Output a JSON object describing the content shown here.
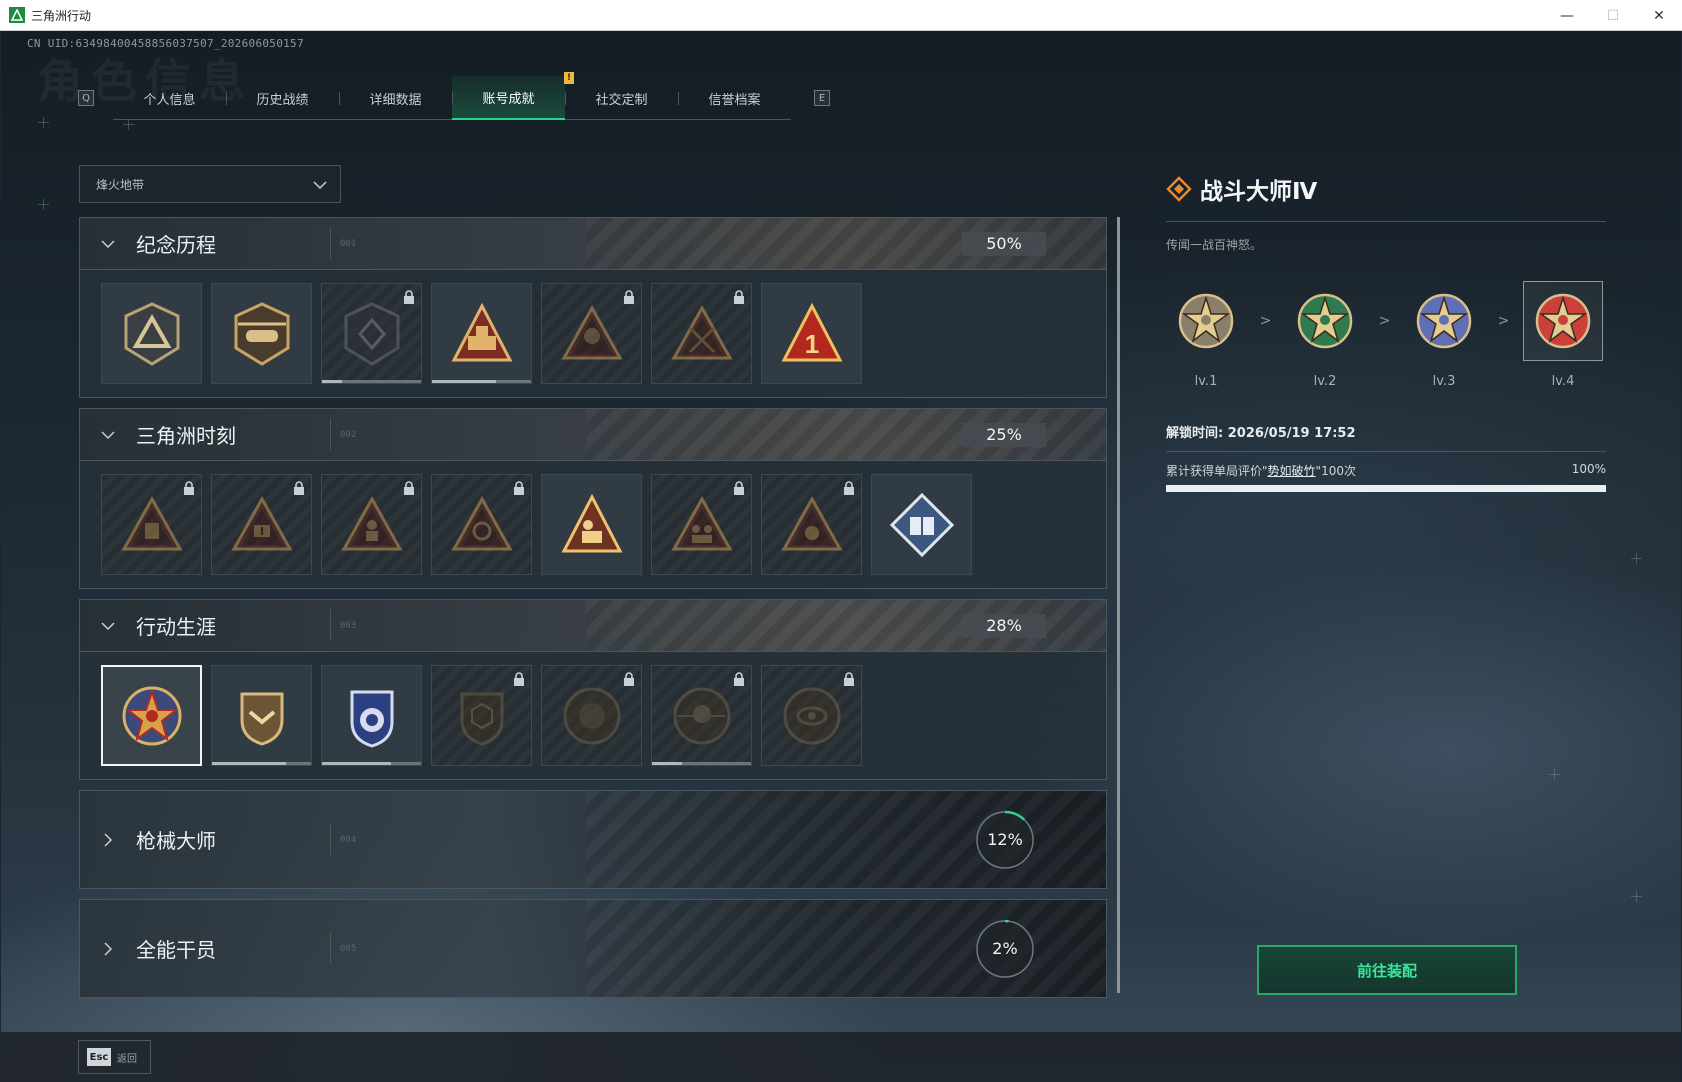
{
  "window": {
    "title": "三角洲行动",
    "minimize": "—",
    "maximize": "☐",
    "close": "✕"
  },
  "uid": "CN UID:6349840045885603750​7_202606050157",
  "bg_title": "角色信息",
  "tabs": {
    "prev_key": "Q",
    "next_key": "E",
    "items": [
      {
        "label": "个人信息"
      },
      {
        "label": "历史战绩"
      },
      {
        "label": "详细数据"
      },
      {
        "label": "账号成就"
      },
      {
        "label": "社交定制"
      },
      {
        "label": "信誉档案"
      }
    ],
    "active": "账号成就",
    "notice": "!"
  },
  "filter": {
    "value": "烽火地带"
  },
  "sections": [
    {
      "name": "纪念历程",
      "code": "001",
      "percent": "50%"
    },
    {
      "name": "三角洲时刻",
      "code": "002",
      "percent": "25%"
    },
    {
      "name": "行动生涯",
      "code": "003",
      "percent": "28%"
    },
    {
      "name": "枪械大师",
      "code": "004",
      "percent": "12%",
      "progress": 0.12
    },
    {
      "name": "全能干员",
      "code": "005",
      "percent": "2%",
      "progress": 0.02
    }
  ],
  "badges": {
    "memorial": [
      {
        "icon": "delta-triangle-badge-icon",
        "locked": false
      },
      {
        "icon": "helicopter-badge-icon",
        "locked": false
      },
      {
        "icon": "shield-emblem-badge-icon",
        "locked": true,
        "progress": 0.2
      },
      {
        "icon": "tank-badge-icon",
        "locked": false,
        "progress": 0.65
      },
      {
        "icon": "hooded-figure-badge-icon",
        "locked": true
      },
      {
        "icon": "crossed-swords-badge-icon",
        "locked": true
      },
      {
        "icon": "number-one-badge-icon",
        "locked": false
      }
    ],
    "moments": [
      {
        "icon": "backpack-triangle-icon",
        "locked": true
      },
      {
        "icon": "medkit-triangle-icon",
        "locked": true
      },
      {
        "icon": "soldier-triangle-icon",
        "locked": true
      },
      {
        "icon": "hands-triangle-icon",
        "locked": true
      },
      {
        "icon": "carry-triangle-icon",
        "locked": false
      },
      {
        "icon": "squad-triangle-icon",
        "locked": true
      },
      {
        "icon": "fist-triangle-icon",
        "locked": true
      },
      {
        "icon": "diamond-book-badge-icon",
        "locked": false
      }
    ],
    "career": [
      {
        "icon": "star-medal-badge-icon",
        "locked": false,
        "selected": true
      },
      {
        "icon": "chevron-shield-badge-icon",
        "locked": false,
        "progress": 0.75
      },
      {
        "icon": "police-shield-badge-icon",
        "locked": false,
        "progress": 0.7
      },
      {
        "icon": "hex-shield-badge-icon",
        "locked": true
      },
      {
        "icon": "orb-badge-icon",
        "locked": true
      },
      {
        "icon": "skull-badge-icon",
        "locked": true,
        "progress": 0.3
      },
      {
        "icon": "eye-badge-icon",
        "locked": true
      }
    ]
  },
  "detail": {
    "title": "战斗大师Ⅳ",
    "description": "传闻一战百神怒。",
    "levels": [
      {
        "label": "lv.1",
        "color": "#8a7f6b"
      },
      {
        "label": "lv.2",
        "color": "#2f7a4e"
      },
      {
        "label": "lv.3",
        "color": "#5f6fb3"
      },
      {
        "label": "lv.4",
        "color": "#c9413a"
      }
    ],
    "level_sep": ">",
    "unlock_time": "解锁时间: 2026/05/19 17:52",
    "condition_prefix": "累计获得单局评价\"",
    "condition_highlight": "势如破竹",
    "condition_suffix": "\"100次",
    "condition_percent": "100%",
    "condition_progress": 1.0,
    "button": "前往装配"
  },
  "footer": {
    "esc_key": "Esc",
    "back_label": "返回"
  },
  "colors": {
    "accent": "#2cd58b",
    "orange": "#e88a2e",
    "notice": "#f3b93a"
  }
}
